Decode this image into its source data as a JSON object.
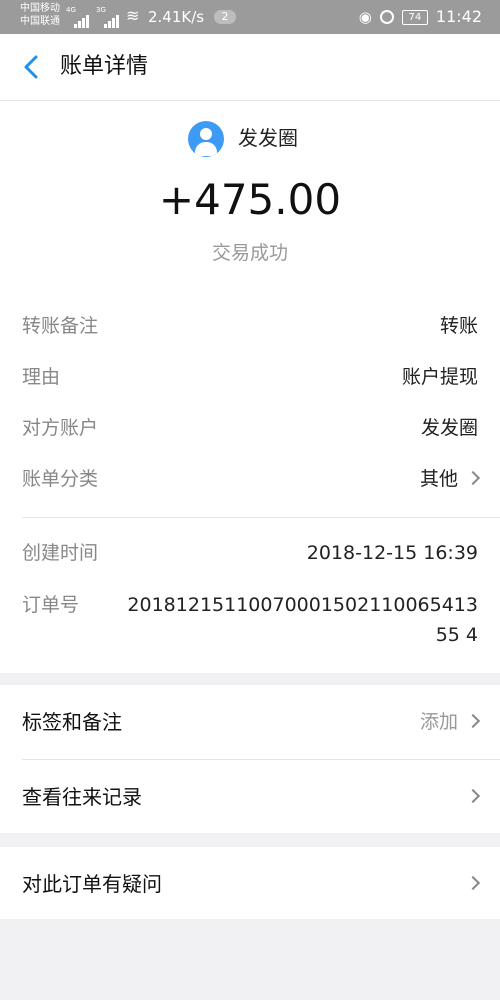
{
  "status_bar": {
    "carrier1": "中国移动",
    "carrier2": "中国联通",
    "net1": "4G",
    "net2": "3G",
    "speed": "2.41K/s",
    "notif_count": "2",
    "battery": "74",
    "time": "11:42"
  },
  "header": {
    "title": "账单详情"
  },
  "summary": {
    "payee": "发发圈",
    "amount": "+475.00",
    "status": "交易成功"
  },
  "details": [
    {
      "label": "转账备注",
      "value": "转账"
    },
    {
      "label": "理由",
      "value": "账户提现"
    },
    {
      "label": "对方账户",
      "value": "发发圈"
    },
    {
      "label": "账单分类",
      "value": "其他"
    }
  ],
  "meta": {
    "created_label": "创建时间",
    "created_value": "2018-12-15 16:39",
    "order_label": "订单号",
    "order_value": "2018121511007000150211006541355 4"
  },
  "actions": {
    "tags_label": "标签和备注",
    "tags_right": "添加",
    "records_label": "查看往来记录",
    "question_label": "对此订单有疑问"
  }
}
